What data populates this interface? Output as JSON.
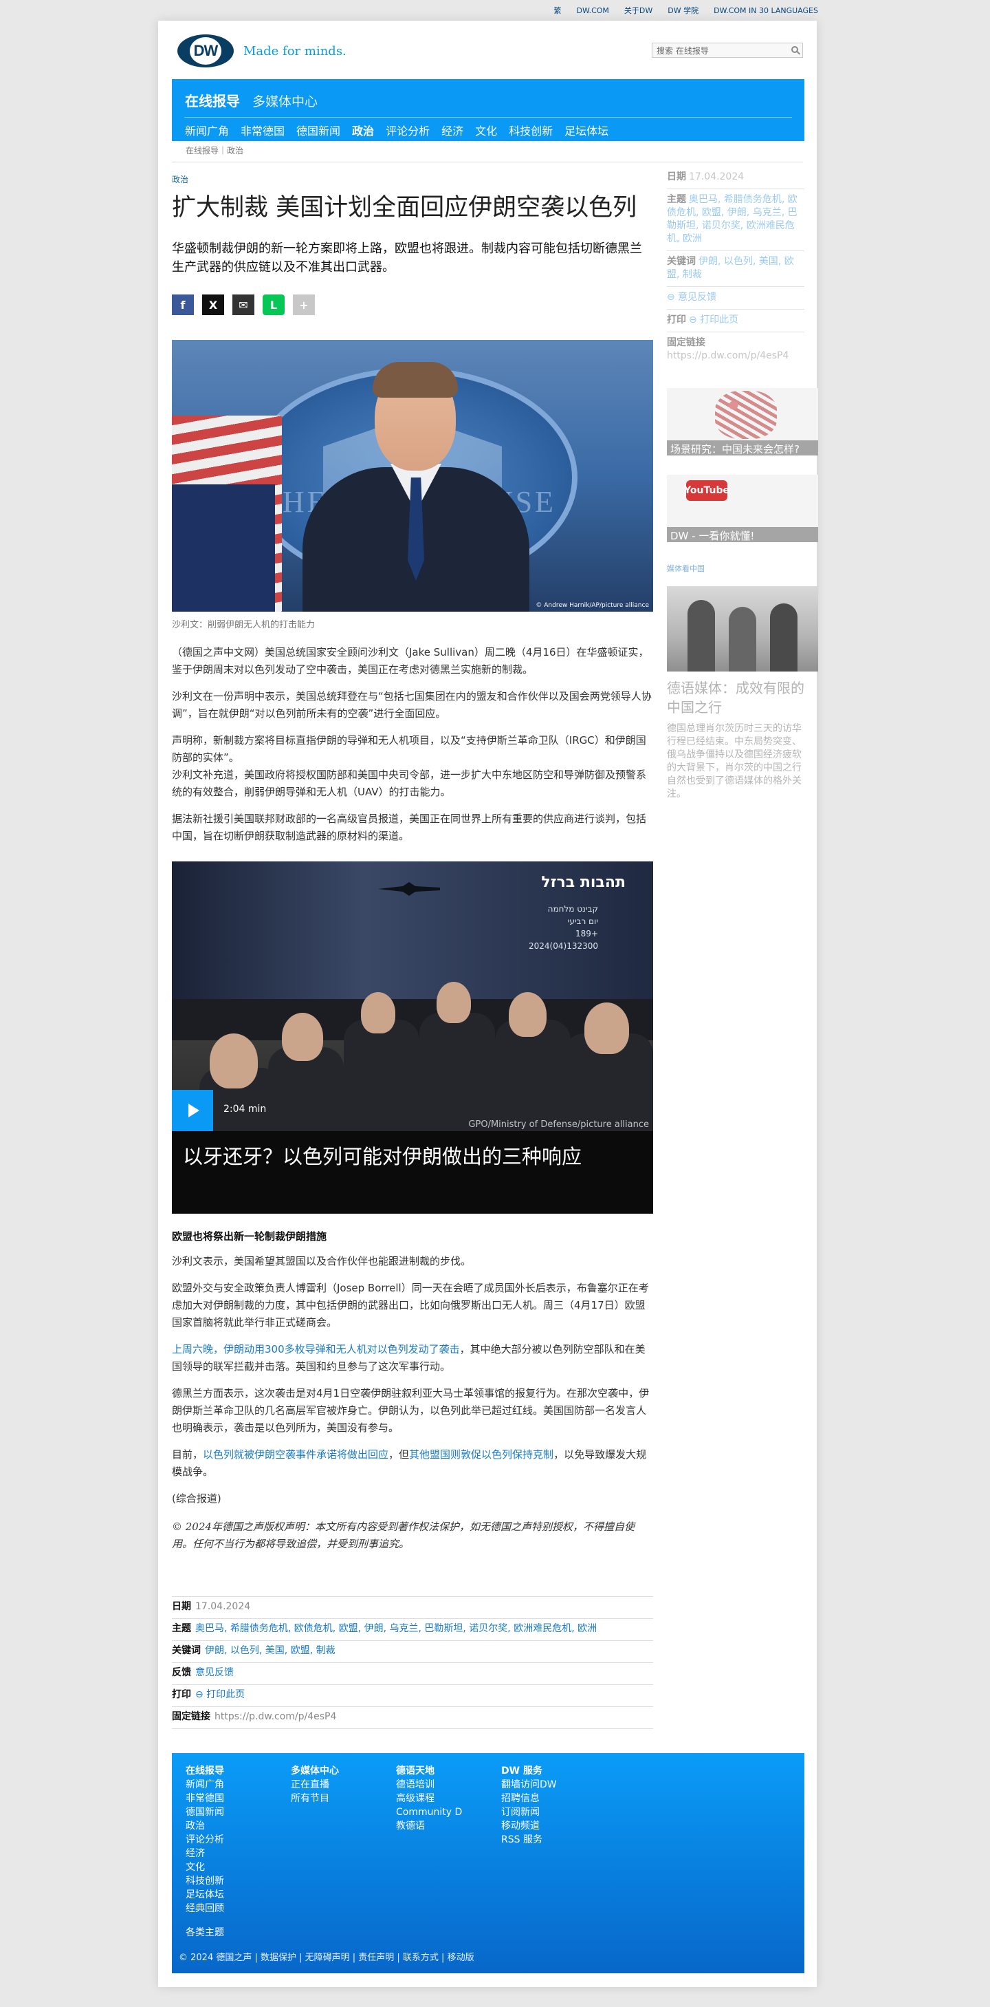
{
  "topbar": {
    "items": [
      "繁",
      "DW.COM",
      "关于DW",
      "DW 学院",
      "DW.COM IN 30 LANGUAGES"
    ]
  },
  "brand": {
    "logo": "DW",
    "tagline": "Made for minds."
  },
  "search": {
    "placeholder": "搜索 在线报导"
  },
  "nav": {
    "primary": [
      "在线报导",
      "多媒体中心"
    ],
    "secondary": [
      "新闻广角",
      "非常德国",
      "德国新闻",
      "政治",
      "评论分析",
      "经济",
      "文化",
      "科技创新",
      "足坛体坛"
    ],
    "active": "政治"
  },
  "breadcrumb": "在线报导｜政治",
  "article": {
    "kicker": "政治",
    "title": "扩大制裁 美国计划全面回应伊朗空袭以色列",
    "lead": "华盛顿制裁伊朗的新一轮方案即将上路，欧盟也将跟进。制裁内容可能包括切断德黑兰生产武器的供应链以及不准其出口武器。",
    "share": [
      "f",
      "X",
      "✉",
      "L",
      "+"
    ],
    "hero_credit": "© Andrew Harnik/AP/picture alliance",
    "caption": "沙利文：削弱伊朗无人机的打击能力",
    "paragraphs": [
      "（德国之声中文网）美国总统国家安全顾问沙利文（Jake Sullivan）周二晚（4月16日）在华盛顿证实，鉴于伊朗周末对以色列发动了空中袭击，美国正在考虑对德黑兰实施新的制裁。",
      "沙利文在一份声明中表示，美国总统拜登在与“包括七国集团在内的盟友和合作伙伴以及国会两党领导人协调”，旨在就伊朗“对以色列前所未有的空袭”进行全面回应。",
      "声明称，新制裁方案将目标直指伊朗的导弹和无人机项目，以及“支持伊斯兰革命卫队（IRGC）和伊朗国防部的实体”。",
      "沙利文补充道，美国政府将授权国防部和美国中央司令部，进一步扩大中东地区防空和导弹防御及预警系统的有效整合，削弱伊朗导弹和无人机（UAV）的打击能力。",
      "据法新社援引美国联邦财政部的一名高级官员报道，美国正在同世界上所有重要的供应商进行谈判，包括中国，旨在切断伊朗获取制造武器的原材料的渠道。"
    ],
    "video": {
      "duration": "2:04 min",
      "credit": "GPO/Ministry of Defense/picture alliance",
      "title": "以牙还牙？以色列可能对伊朗做出的三种响应",
      "hebrew_title": "תהבות ברזל",
      "hebrew_sub": "קבינט מלחמה\nיום רביעי\n189+\n2024(04)132300"
    },
    "section_heading": "欧盟也将祭出新一轮制裁伊朗措施",
    "paragraphs2": [
      "沙利文表示，美国希望其盟国以及合作伙伴也能跟进制裁的步伐。",
      "欧盟外交与安全政策负责人博雷利（Josep Borrell）同一天在会晤了成员国外长后表示，布鲁塞尔正在考虑加大对伊朗制裁的力度，其中包括伊朗的武器出口，比如向俄罗斯出口无人机。周三（4月17日）欧盟国家首脑将就此举行非正式磋商会。"
    ],
    "p_link1": "上周六晚，伊朗动用300多枚导弹和无人机对以色列发动了袭击",
    "p_link1_rest": "，其中绝大部分被以色列防空部队和在美国领导的联军拦截并击落。英国和约旦参与了这次军事行动。",
    "p_middle": "德黑兰方面表示，这次袭击是对4月1日空袭伊朗驻叙利亚大马士革领事馆的报复行为。在那次空袭中，伊朗伊斯兰革命卫队的几名高层军官被炸身亡。伊朗认为，以色列此举已超过红线。美国国防部一名发言人也明确表示，袭击是以色列所为，美国没有参与。",
    "p_last_a": "目前，",
    "p_last_link1": "以色列就被伊朗空袭事件承诺将做出回应",
    "p_last_b": "，但",
    "p_last_link2": "其他盟国则敦促以色列保持克制",
    "p_last_c": "，以免导致爆发大规模战争。",
    "source": "(综合报道)",
    "copyright": "© 2024年德国之声版权声明：本文所有内容受到著作权法保护，如无德国之声特别授权，不得擅自使用。任何不当行为都将导致追偿，并受到刑事追究。"
  },
  "meta": {
    "date_label": "日期",
    "date": "17.04.2024",
    "topics_label": "主题",
    "topics": "奥巴马, 希腊债务危机, 欧债危机, 欧盟, 伊朗, 乌克兰, 巴勒斯坦, 诺贝尔奖, 欧洲难民危机, 欧洲",
    "keywords_label": "关键词",
    "keywords": "伊朗, 以色列, 美国, 欧盟, 制裁",
    "feedback_label": "反馈",
    "feedback": "意见反馈",
    "print_label": "打印",
    "print": "⊖ 打印此页",
    "permalink_label": "固定链接",
    "permalink": "https://p.dw.com/p/4esP4"
  },
  "sidebar": {
    "date_label": "日期",
    "date": "17.04.2024",
    "topics_label": "主题",
    "topics": "奥巴马, 希腊债务危机, 欧债危机, 欧盟, 伊朗, 乌克兰, 巴勒斯坦, 诺贝尔奖, 欧洲难民危机, 欧洲",
    "keywords_label": "关键词",
    "keywords": "伊朗, 以色列, 美国, 欧盟, 制裁",
    "feedback": "⊖ 意见反馈",
    "print_label": "打印",
    "print": "⊖ 打印此页",
    "permalink_label": "固定链接",
    "permalink": "https://p.dw.com/p/4esP4",
    "tile1": "场景研究：中国未来会怎样?",
    "tile2": "DW - 一看你就懂!",
    "tile2_logo": "YouTube",
    "media_label": "媒体看中国",
    "media_title": "德语媒体：成效有限的中国之行",
    "media_desc": "德国总理肖尔茨历时三天的访华行程已经结束。中东局势突变、俄乌战争僵持以及德国经济疲软的大背景下，肖尔茨的中国之行自然也受到了德语媒体的格外关注。"
  },
  "footer": {
    "col1_head": "在线报导",
    "col1": [
      "新闻广角",
      "非常德国",
      "德国新闻",
      "政治",
      "评论分析",
      "经济",
      "文化",
      "科技创新",
      "足坛体坛",
      "经典回顾"
    ],
    "col2_head": "多媒体中心",
    "col2": [
      "正在直播",
      "所有节目"
    ],
    "col3_head": "德语天地",
    "col3": [
      "德语培训",
      "高级课程",
      "Community D",
      "教德语"
    ],
    "col4_head": "DW 服务",
    "col4": [
      "翻墙访问DW",
      "招聘信息",
      "订阅新闻",
      "移动频道",
      "RSS 服务"
    ],
    "themes": "各类主题",
    "bottom": "© 2024 德国之声 | 数据保护 | 无障碍声明 | 责任声明 | 联系方式 | 移动版"
  }
}
